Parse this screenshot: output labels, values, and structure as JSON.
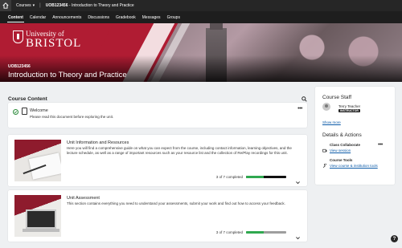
{
  "topbar": {
    "home_icon": "home-icon",
    "courses_label": "Courses",
    "course_code": "UOB123456",
    "course_crumb_title": " - Introduction to Theory and Practice"
  },
  "nav": {
    "tabs": [
      {
        "label": "Content",
        "active": true
      },
      {
        "label": "Calendar"
      },
      {
        "label": "Announcements"
      },
      {
        "label": "Discussions"
      },
      {
        "label": "Gradebook"
      },
      {
        "label": "Messages"
      },
      {
        "label": "Groups"
      }
    ]
  },
  "banner": {
    "logo_line1": "University of",
    "logo_line2": "BRISTOL",
    "course_code": "UOB123456",
    "course_title": "Introduction to Theory and Practice",
    "brand_color": "#b01c33"
  },
  "main": {
    "heading": "Course Content",
    "welcome": {
      "title": "Welcome",
      "description": "Please read this document before exploring the unit."
    },
    "modules": [
      {
        "title": "Unit Information and Resources",
        "description": "Here you will find a comprehensive guide on what you can expect from the course, including contact information, learning objectives, and the lecture schedule, as well as a range of important resources such as your resource list and the collection of Re/Play recordings for this unit.",
        "progress_text": "3 of 7 completed",
        "progress_fraction": 0.43
      },
      {
        "title": "Unit Assessment",
        "description": "This section contains everything you need to understand your assessments, submit your work and find out how to access your feedback.",
        "progress_text": "3 of 7 completed",
        "progress_fraction": 0.43
      }
    ]
  },
  "side": {
    "staff_title": "Course Staff",
    "staff_name": "Terry Teacher",
    "staff_role": "INSTRUCTOR",
    "show_more": "Show more",
    "details_title": "Details & Actions",
    "tools": [
      {
        "title": "Class Collaborate",
        "link": "View session"
      },
      {
        "title": "Course Tools",
        "link": "View course & institution tools"
      }
    ]
  },
  "help_label": "?"
}
